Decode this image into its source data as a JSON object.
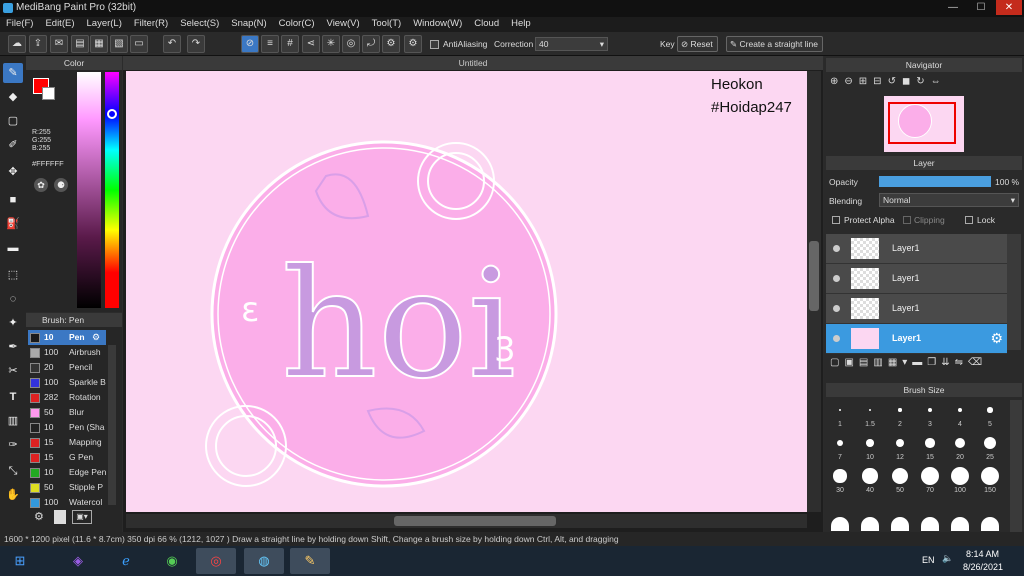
{
  "window": {
    "title": "MediBang Paint Pro (32bit)",
    "minimize": "—",
    "maximize": "☐",
    "close": "✕"
  },
  "menu": [
    "File(F)",
    "Edit(E)",
    "Layer(L)",
    "Filter(R)",
    "Select(S)",
    "Snap(N)",
    "Color(C)",
    "View(V)",
    "Tool(T)",
    "Window(W)",
    "Cloud",
    "Help"
  ],
  "toolbar": {
    "antialiasing_label": "AntiAliasing",
    "correction_label": "Correction",
    "correction_value": "40",
    "key_label": "Key",
    "reset_label": "Reset",
    "straight_line_label": "Create a straight line"
  },
  "color_panel": {
    "title": "Color",
    "r": "R:255",
    "g": "G:255",
    "b": "B:255",
    "hex": "#FFFFFF",
    "current_color": "#ff0000"
  },
  "brush_panel": {
    "title": "Brush: Pen",
    "brushes": [
      {
        "size": "10",
        "name": "Pen",
        "color": "#1a1a1a"
      },
      {
        "size": "100",
        "name": "Airbrush",
        "color": "#aaaaaa"
      },
      {
        "size": "20",
        "name": "Pencil",
        "color": "#333333"
      },
      {
        "size": "100",
        "name": "Sparkle B",
        "color": "#3333dd"
      },
      {
        "size": "282",
        "name": "Rotation",
        "color": "#dd2222"
      },
      {
        "size": "50",
        "name": "Blur",
        "color": "#ff99ee"
      },
      {
        "size": "10",
        "name": "Pen (Sha",
        "color": "#222222"
      },
      {
        "size": "15",
        "name": "Mapping",
        "color": "#dd2222"
      },
      {
        "size": "15",
        "name": "G Pen",
        "color": "#dd2222"
      },
      {
        "size": "10",
        "name": "Edge Pen",
        "color": "#22aa22"
      },
      {
        "size": "50",
        "name": "Stipple P",
        "color": "#dddd22"
      },
      {
        "size": "100",
        "name": "Watercol",
        "color": "#3399dd"
      }
    ]
  },
  "document": {
    "tab_title": "Untitled",
    "watermark_line1": "Heokon",
    "watermark_line2": "#Hoidap247",
    "artwork_text": "hoi",
    "deco_left": "ε",
    "deco_right": "3"
  },
  "navigator": {
    "title": "Navigator"
  },
  "layer_panel": {
    "title": "Layer",
    "opacity_label": "Opacity",
    "opacity_value": "100 %",
    "opacity_fraction": 1.0,
    "blending_label": "Blending",
    "blending_value": "Normal",
    "protect_alpha": "Protect Alpha",
    "clipping": "Clipping",
    "lock": "Lock",
    "layers": [
      "Layer1",
      "Layer1",
      "Layer1",
      "Layer1"
    ]
  },
  "brush_size_panel": {
    "title": "Brush Size",
    "sizes": [
      "1",
      "1.5",
      "2",
      "3",
      "4",
      "5",
      "7",
      "10",
      "12",
      "15",
      "20",
      "25",
      "30",
      "40",
      "50",
      "70",
      "100",
      "150"
    ]
  },
  "status": {
    "text": "1600 * 1200 pixel   (11.6 * 8.7cm)   350 dpi   66 %   (1212, 1027 )   Draw a straight line by holding down Shift, Change a brush size by holding down Ctrl, Alt, and dragging"
  },
  "taskbar": {
    "lang": "EN",
    "time": "8:14 AM",
    "date": "8/26/2021"
  }
}
